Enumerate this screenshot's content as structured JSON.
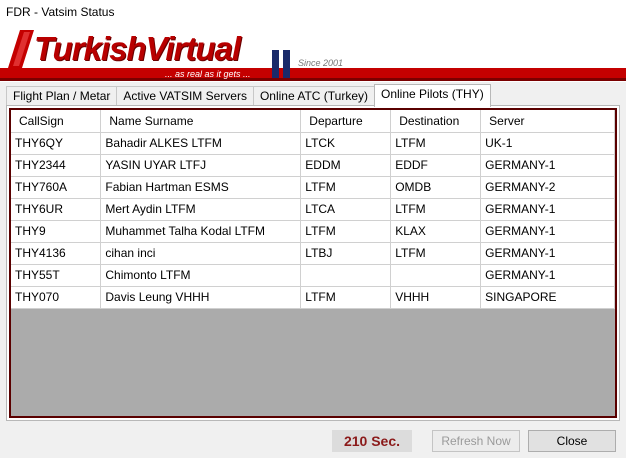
{
  "window": {
    "title": "FDR - Vatsim Status"
  },
  "banner": {
    "brand": "TurkishVirtual",
    "tagline": "... as real as it gets ...",
    "since": "Since 2001",
    "colors": {
      "primary": "#c40000",
      "dark": "#7a0000"
    }
  },
  "tabs": [
    {
      "label": "Flight Plan / Metar",
      "active": false
    },
    {
      "label": "Active VATSIM Servers",
      "active": false
    },
    {
      "label": "Online ATC (Turkey)",
      "active": false
    },
    {
      "label": "Online Pilots (THY)",
      "active": true
    }
  ],
  "pilots": {
    "columns": [
      "CallSign",
      "Name Surname",
      "Departure",
      "Destination",
      "Server"
    ],
    "rows": [
      [
        "THY6QY",
        "Bahadir ALKES LTFM",
        "LTCK",
        "LTFM",
        "UK-1"
      ],
      [
        "THY2344",
        "YASIN UYAR LTFJ",
        "EDDM",
        "EDDF",
        "GERMANY-1"
      ],
      [
        "THY760A",
        "Fabian Hartman ESMS",
        "LTFM",
        "OMDB",
        "GERMANY-2"
      ],
      [
        "THY6UR",
        "Mert Aydin LTFM",
        "LTCA",
        "LTFM",
        "GERMANY-1"
      ],
      [
        "THY9",
        "Muhammet Talha Kodal LTFM",
        "LTFM",
        "KLAX",
        "GERMANY-1"
      ],
      [
        "THY4136",
        "cihan inci",
        "LTBJ",
        "LTFM",
        "GERMANY-1"
      ],
      [
        "THY55T",
        "Chimonto LTFM",
        "",
        "",
        "GERMANY-1"
      ],
      [
        "THY070",
        "Davis Leung VHHH",
        "LTFM",
        "VHHH",
        "SINGAPORE"
      ]
    ]
  },
  "footer": {
    "counter": "210 Sec.",
    "refresh_label": "Refresh Now",
    "close_label": "Close"
  }
}
